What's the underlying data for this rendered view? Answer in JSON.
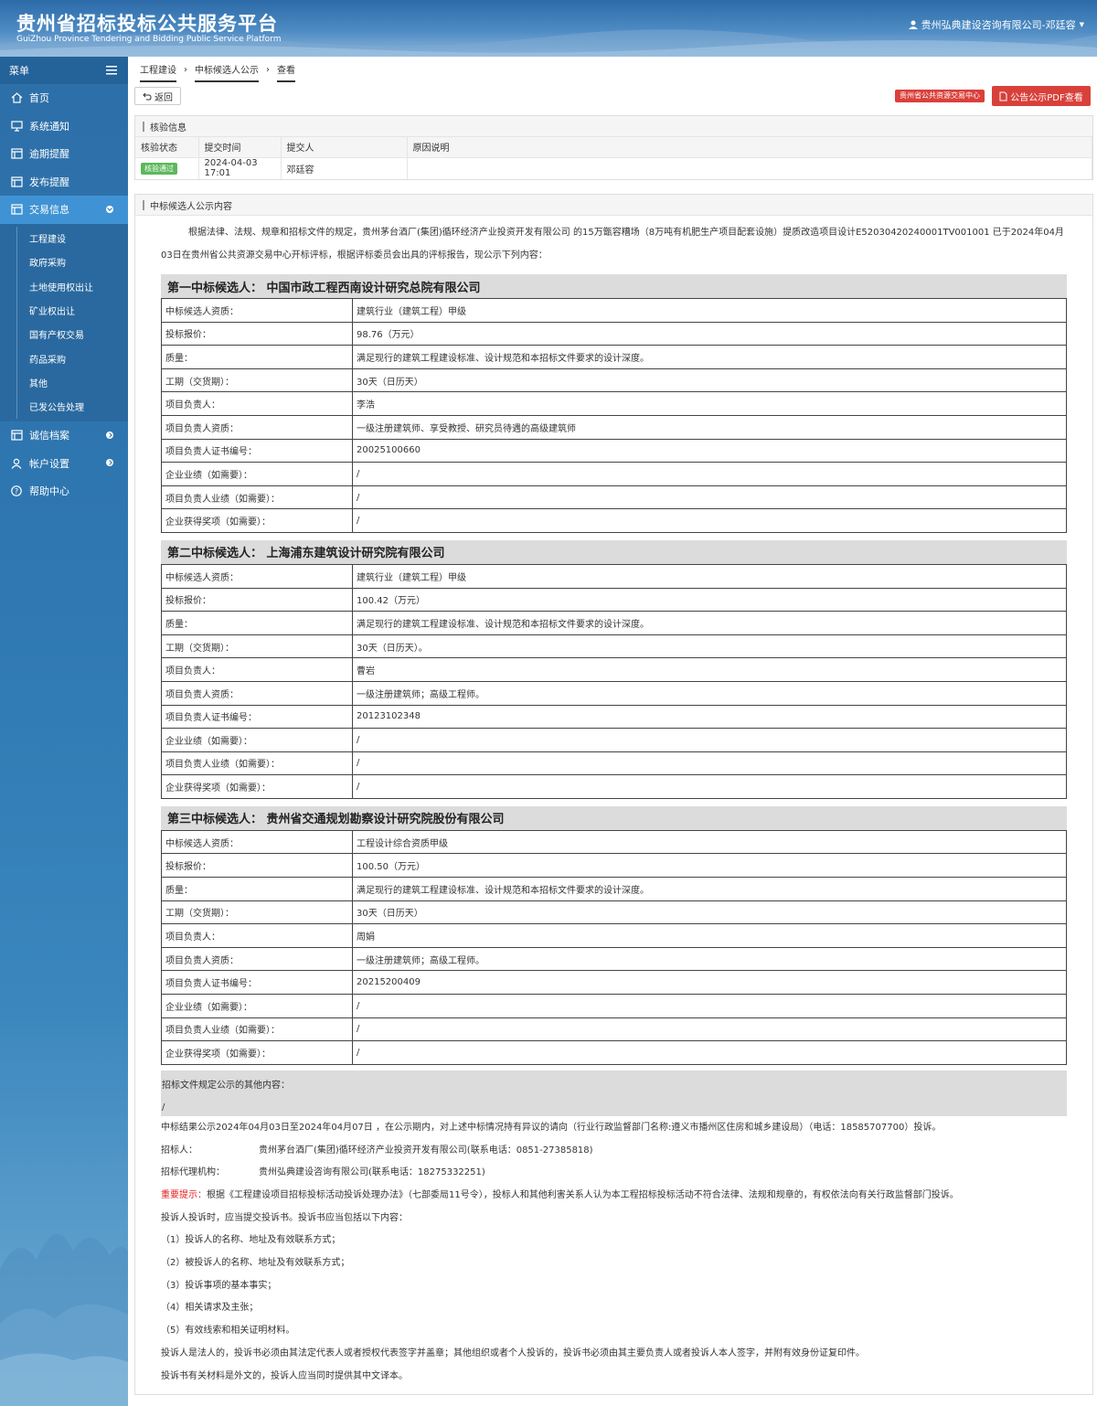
{
  "header": {
    "title": "贵州省招标投标公共服务平台",
    "subtitle": "GuiZhou Province Tendering and Bidding Public Service Platform",
    "user": "贵州弘典建设咨询有限公司-邓廷容"
  },
  "sidebar": {
    "menu_label": "菜单",
    "items": [
      {
        "label": "首页"
      },
      {
        "label": "系统通知"
      },
      {
        "label": "逾期提醒"
      },
      {
        "label": "发布提醒"
      },
      {
        "label": "交易信息"
      }
    ],
    "sub_items": [
      "工程建设",
      "政府采购",
      "土地使用权出让",
      "矿业权出让",
      "国有产权交易",
      "药品采购",
      "其他",
      "已发公告处理"
    ],
    "items_after": [
      {
        "label": "诚信档案"
      },
      {
        "label": "帐户设置"
      },
      {
        "label": "帮助中心"
      }
    ]
  },
  "breadcrumb": [
    "工程建设",
    "中标候选人公示",
    "查看"
  ],
  "toolbar": {
    "back_label": "返回",
    "center_tag": "贵州省公共资源交易中心",
    "pdf_label": "公告公示PDF查看"
  },
  "verify": {
    "title": "核验信息",
    "headers": [
      "核验状态",
      "提交时间",
      "提交人",
      "原因说明"
    ],
    "status": "核验通过",
    "time": "2024-04-03 17:01",
    "submitter": "邓廷容",
    "reason": ""
  },
  "content": {
    "title": "中标候选人公示内容",
    "intro": "根据法律、法规、规章和招标文件的规定，贵州茅台酒厂(集团)循环经济产业投资开发有限公司 的15万甑容糟场（8万吨有机肥生产项目配套设施）提质改造项目设计E5203042024000​1TV001001 已于2024年04月03日在贵州省公共资源交易中心开标评标，根据评标委员会出具的评标报告，现公示下列内容：",
    "candidates": [
      {
        "title": "第一中标候选人： 中国市政工程西南设计研究总院有限公司",
        "rows": [
          [
            "中标候选人资质：",
            "建筑行业（建筑工程）甲级"
          ],
          [
            "投标报价：",
            "98.76（万元）"
          ],
          [
            "质量：",
            "满足现行的建筑工程建设标准、设计规范和本招标文件要求的设计深度。"
          ],
          [
            "工期（交货期）：",
            "30天（日历天）"
          ],
          [
            "项目负责人：",
            "李浩"
          ],
          [
            "项目负责人资质：",
            "一级注册建筑师、享受教授、研究员待遇的高级建筑师"
          ],
          [
            "项目负责人证书编号：",
            "20025100660"
          ],
          [
            "企业业绩（如需要）：",
            "/"
          ],
          [
            "项目负责人业绩（如需要）：",
            "/"
          ],
          [
            "企业获得奖项（如需要）：",
            "/"
          ]
        ]
      },
      {
        "title": "第二中标候选人： 上海浦东建筑设计研究院有限公司",
        "rows": [
          [
            "中标候选人资质：",
            "建筑行业（建筑工程）甲级"
          ],
          [
            "投标报价：",
            "100.42（万元）"
          ],
          [
            "质量：",
            "满足现行的建筑工程建设标准、设计规范和本招标文件要求的设计深度。"
          ],
          [
            "工期（交货期）：",
            "30天（日历天）。"
          ],
          [
            "项目负责人：",
            "曹岩"
          ],
          [
            "项目负责人资质：",
            "一级注册建筑师；高级工程师。"
          ],
          [
            "项目负责人证书编号：",
            "20123102348"
          ],
          [
            "企业业绩（如需要）：",
            "/"
          ],
          [
            "项目负责人业绩（如需要）：",
            "/"
          ],
          [
            "企业获得奖项（如需要）：",
            "/"
          ]
        ]
      },
      {
        "title": "第三中标候选人： 贵州省交通规划勘察设计研究院股份有限公司",
        "rows": [
          [
            "中标候选人资质：",
            "工程设计综合资质甲级"
          ],
          [
            "投标报价：",
            "100.50（万元）"
          ],
          [
            "质量：",
            "满足现行的建筑工程建设标准、设计规范和本招标文件要求的设计深度。"
          ],
          [
            "工期（交货期）：",
            "30天（日历天）"
          ],
          [
            "项目负责人：",
            "周娟"
          ],
          [
            "项目负责人资质：",
            "一级注册建筑师；高级工程师。"
          ],
          [
            "项目负责人证书编号：",
            "20215200409"
          ],
          [
            "企业业绩（如需要）：",
            "/"
          ],
          [
            "项目负责人业绩（如需要）：",
            "/"
          ],
          [
            "企业获得奖项（如需要）：",
            "/"
          ]
        ]
      }
    ],
    "other_title": "招标文件规定公示的其他内容：",
    "other_value": "/",
    "period": "中标结果公示2024年04月03日至2024年04月07日 ，在公示期内，对上述中标情况持有异议的请向（行业行政监督部门名称:遵义市播州区住房和城乡建设局）（电话：18585707700）投诉。",
    "tenderer_label": "招标人：",
    "tenderer": "贵州茅台酒厂(集团)循环经济产业投资开发有限公司(联系电话：0851-27385818)",
    "agent_label": "招标代理机构：",
    "agent": "贵州弘典建设咨询有限公司(联系电话：18275332251)",
    "warn_label": "重要提示：",
    "warn_text": "根据《工程建设项目招标投标活动投诉处理办法》（七部委局11号令），投标人和其他利害关系人认为本工程招标投标活动不符合法律、法规和规章的，有权依法向有关行政监督部门投诉。",
    "notes": [
      "投诉人投诉时，应当提交投诉书。投诉书应当包括以下内容：",
      "（1）投诉人的名称、地址及有效联系方式；",
      "（2）被投诉人的名称、地址及有效联系方式；",
      "（3）投诉事项的基本事实；",
      "（4）相关请求及主张；",
      "（5）有效线索和相关证明材料。",
      "投诉人是法人的，投诉书必须由其法定代表人或者授权代表签字并盖章；其他组织或者个人投诉的，投诉书必须由其主要负责人或者投诉人本人签字，并附有效身份证复印件。",
      "投诉书有关材料是外文的，投诉人应当同时提供其中文译本。"
    ]
  }
}
